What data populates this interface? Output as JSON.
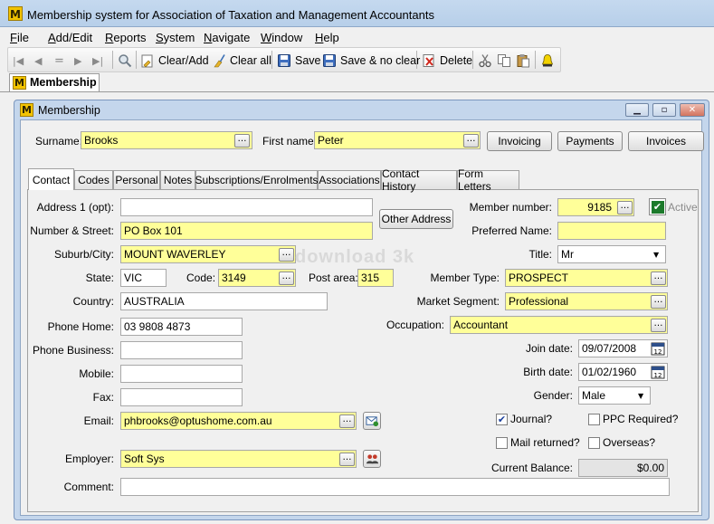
{
  "window": {
    "title": "Membership system for Association of Taxation and Management Accountants"
  },
  "menu": [
    {
      "first": "F",
      "rest": "ile"
    },
    {
      "first": "A",
      "rest": "dd/Edit"
    },
    {
      "first": "R",
      "rest": "eports"
    },
    {
      "first": "S",
      "rest": "ystem"
    },
    {
      "first": "N",
      "rest": "avigate"
    },
    {
      "first": "W",
      "rest": "indow"
    },
    {
      "first": "H",
      "rest": "elp"
    }
  ],
  "toolbar": {
    "clear_add": "Clear/Add",
    "clear_all": "Clear all",
    "save": "Save",
    "save_no_clear": "Save & no clear",
    "delete": "Delete"
  },
  "doc_tab": "Membership",
  "child": {
    "title": "Membership",
    "icon_letter": "M"
  },
  "header": {
    "surname_label": "Surname:",
    "surname": "Brooks",
    "first_name_label": "First name:",
    "first_name": "Peter",
    "invoicing": "Invoicing",
    "payments": "Payments",
    "invoices": "Invoices"
  },
  "tabs": [
    "Contact",
    "Codes",
    "Personal",
    "Notes",
    "Subscriptions/Enrolments",
    "Associations",
    "Contact History",
    "Form Letters"
  ],
  "contact": {
    "address1_label": "Address 1 (opt):",
    "address1": "",
    "number_street_label": "Number & Street:",
    "number_street": "PO Box 101",
    "other_address": "Other Address",
    "suburb_label": "Suburb/City:",
    "suburb": "MOUNT WAVERLEY",
    "state_label": "State:",
    "state": "VIC",
    "code_label": "Code:",
    "code": "3149",
    "post_area_label": "Post area:",
    "post_area": "315",
    "country_label": "Country:",
    "country": "AUSTRALIA",
    "phone_home_label": "Phone Home:",
    "phone_home": "03 9808 4873",
    "phone_business_label": "Phone Business:",
    "phone_business": "",
    "mobile_label": "Mobile:",
    "mobile": "",
    "fax_label": "Fax:",
    "fax": "",
    "email_label": "Email:",
    "email": "phbrooks@optushome.com.au",
    "employer_label": "Employer:",
    "employer": "Soft Sys",
    "comment_label": "Comment:",
    "comment": "",
    "member_number_label": "Member number:",
    "member_number": "9185",
    "active_label": "Active",
    "preferred_name_label": "Preferred Name:",
    "preferred_name": "",
    "title_label": "Title:",
    "title": "Mr",
    "member_type_label": "Member Type:",
    "member_type": "PROSPECT",
    "market_segment_label": "Market Segment:",
    "market_segment": "Professional",
    "occupation_label": "Occupation:",
    "occupation": "Accountant",
    "join_date_label": "Join date:",
    "join_date": "09/07/2008",
    "birth_date_label": "Birth date:",
    "birth_date": "01/02/1960",
    "gender_label": "Gender:",
    "gender": "Male",
    "journal_label": "Journal?",
    "ppc_label": "PPC Required?",
    "mail_returned_label": "Mail returned?",
    "overseas_label": "Overseas?",
    "current_balance_label": "Current Balance:",
    "current_balance": "$0.00"
  },
  "checks": {
    "active": true,
    "journal": true,
    "ppc": false,
    "mail_returned": false,
    "overseas": false
  },
  "watermark": "download 3k",
  "colors": {
    "required_field": "#ffff99",
    "title_bar": "#c5d9ef",
    "close_button": "#d2735f"
  }
}
